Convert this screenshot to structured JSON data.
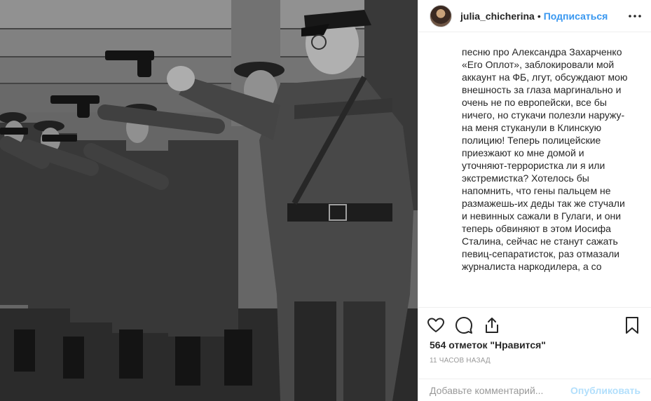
{
  "post": {
    "username": "julia_chicherina",
    "separator": "•",
    "follow_label": "Подписаться",
    "more_icon": "more-dots-icon",
    "caption_user": "julia_chicherina",
    "caption_text": " Травля за песню. Идет постоянная травля в сети за песню про Александра Захарченко «Его Оплот», заблокировали мой аккаунт на ФБ, лгут, обсуждают мою внешность за глаза маргинально и очень не по европейски, все бы ничего, но стукачи полезли наружу- на меня стуканули в Клинскую полицию! Теперь полицейские приезжают ко мне домой и уточняют-террористка ли я или экстремистка? Хотелось бы напомнить, что гены пальцем не размажешь-их деды так же стучали и невинных сажали в Гулаги, и они теперь обвиняют в этом Иосифа Сталина, сейчас не станут сажать певиц-сепаратисток, раз отмазали журналиста наркодилера, а со",
    "likes": "564 отметок \"Нравится\"",
    "timestamp": "11 часов назад",
    "comment_placeholder": "Добавьте комментарий...",
    "publish_label": "Опубликовать",
    "icons": {
      "like": "heart-icon",
      "comment": "comment-bubble-icon",
      "share": "share-icon",
      "save": "bookmark-icon"
    },
    "colors": {
      "follow": "#3897f0",
      "publish_disabled": "#b2dffc",
      "text": "#262626",
      "muted": "#999999",
      "border": "#efefef"
    }
  }
}
